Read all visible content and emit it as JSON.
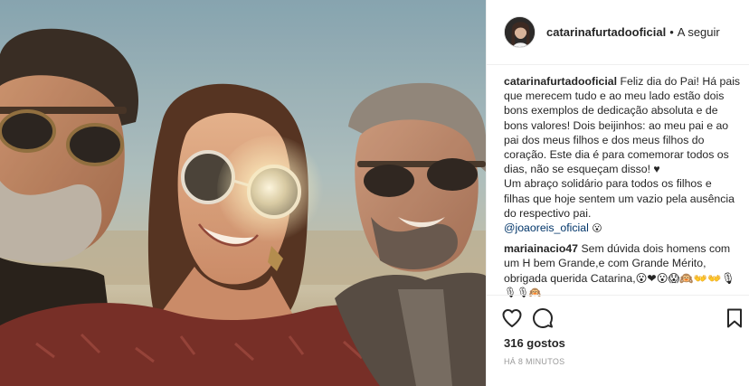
{
  "header": {
    "username": "catarinafurtadooficial",
    "separator": "•",
    "follow_label": "A seguir"
  },
  "caption": {
    "username": "catarinafurtadooficial",
    "lines": [
      "Feliz dia do Pai! Há pais",
      "que merecem tudo e ao meu lado estão dois",
      "bons exemplos de dedicação absoluta e de",
      "bons valores! Dois beijinhos: ao meu pai e ao",
      "pai dos meus filhos e dos meus filhos do",
      "coração. Este dia é para comemorar todos os",
      "dias, não se esqueçam disso! ♥",
      "Um abraço solidário para todos os filhos e",
      "filhas que hoje sentem um vazio pela ausência",
      "do respectivo pai."
    ],
    "mention": "@joaoreis_oficial",
    "mention_emoji": "😮"
  },
  "comment": {
    "username": "mariainacio47",
    "lines": [
      "Sem dúvida dois homens com",
      "um H bem Grande,e com Grande Mérito,",
      "obrigada querida Catarina,😮❤😮😱🙉👐👐🎙",
      "🎙🎙🙉"
    ]
  },
  "actions": {
    "like_icon": "heart-outline-icon",
    "comment_icon": "speech-bubble-icon",
    "save_icon": "bookmark-icon"
  },
  "likes_text": "316 gostos",
  "timestamp": "HÁ 8 MINUTOS"
}
